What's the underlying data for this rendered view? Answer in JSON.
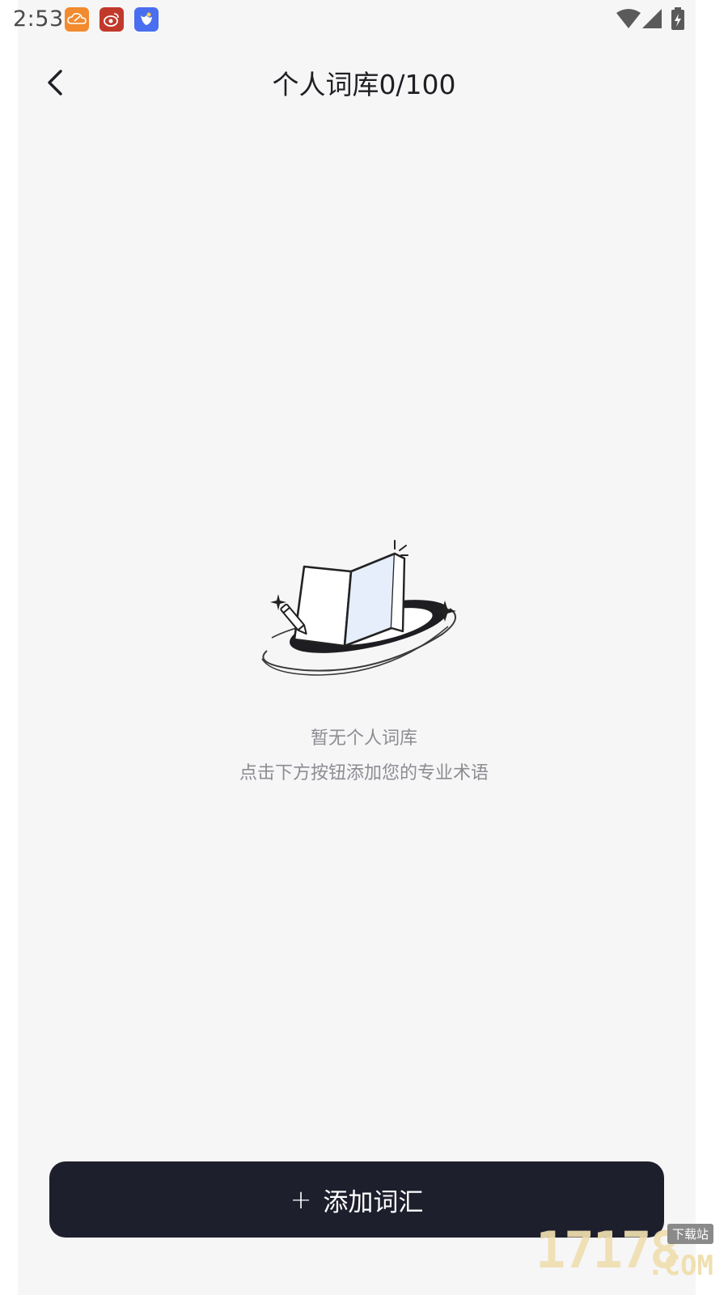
{
  "status_bar": {
    "time": "2:53",
    "notification_icons": [
      "cloud-note-icon",
      "weibo-icon",
      "bird-app-icon"
    ],
    "right_icons": [
      "wifi-icon",
      "cellular-signal-icon",
      "battery-charging-icon"
    ]
  },
  "header": {
    "back_icon": "chevron-left-icon",
    "title": "个人词库0/100"
  },
  "empty_state": {
    "illustration": "open-book-icon",
    "title": "暂无个人词库",
    "hint": "点击下方按钮添加您的专业术语"
  },
  "add_button": {
    "icon": "+",
    "label": "添加词汇"
  },
  "watermark": {
    "number": "17178",
    "domain": ".COM",
    "badge": "下载站"
  },
  "colors": {
    "background": "#f6f6f7",
    "button_bg": "#1e1f2d",
    "title_text": "#1f1f24",
    "hint_text": "#8c8c92",
    "illustration_accent": "#e6eefc"
  }
}
